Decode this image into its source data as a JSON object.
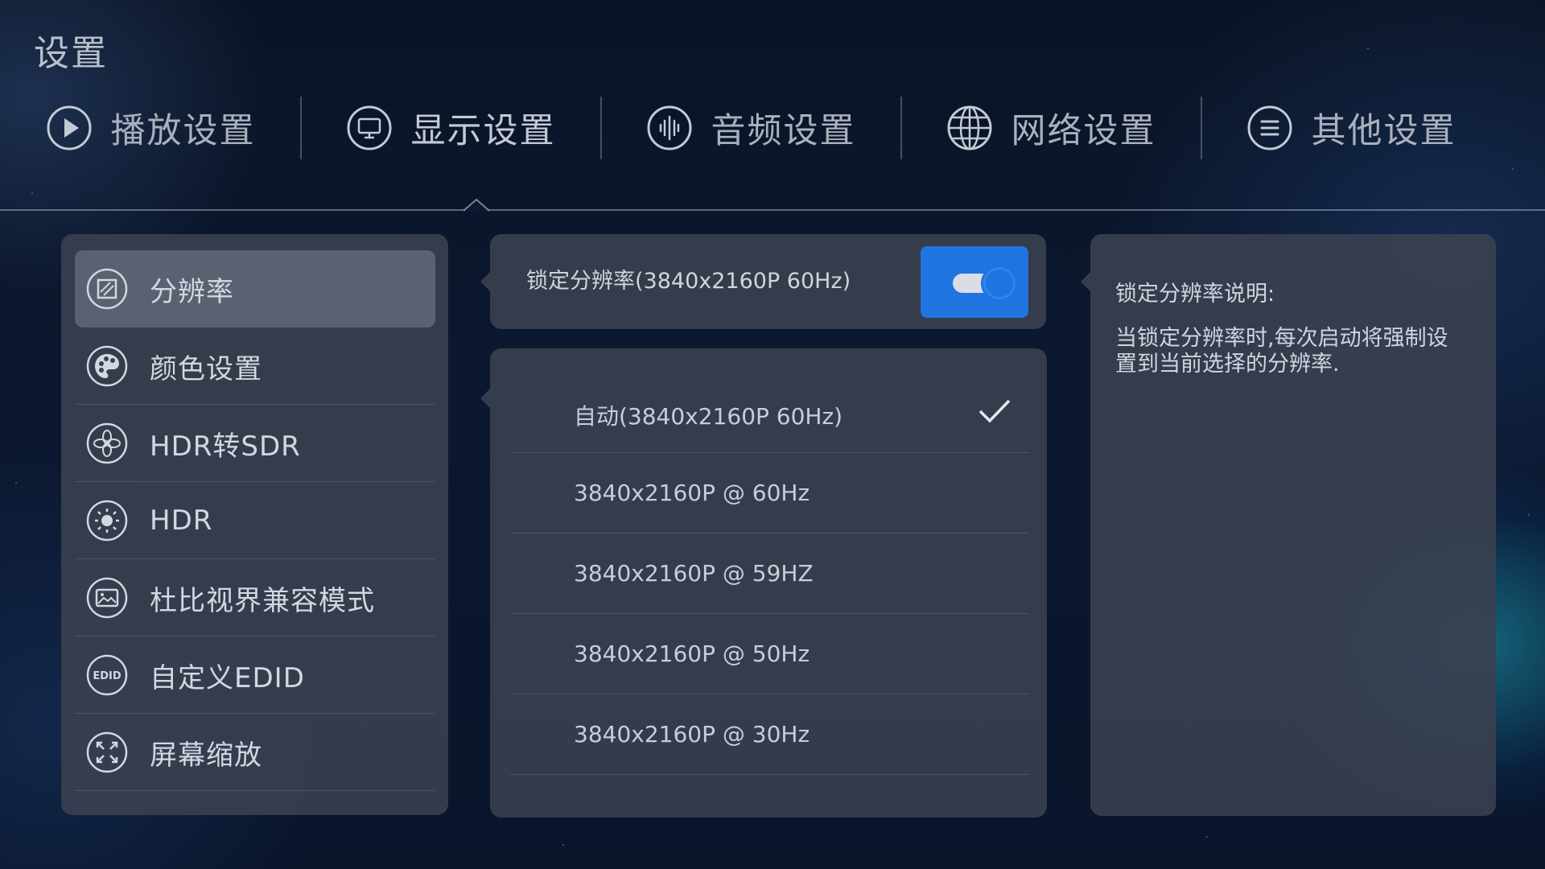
{
  "page": {
    "title": "设置"
  },
  "tabs": [
    {
      "label": "播放设置",
      "icon": "play-circle-icon"
    },
    {
      "label": "显示设置",
      "icon": "monitor-icon"
    },
    {
      "label": "音频设置",
      "icon": "audio-wave-icon"
    },
    {
      "label": "网络设置",
      "icon": "globe-icon"
    },
    {
      "label": "其他设置",
      "icon": "menu-list-icon"
    }
  ],
  "active_tab": 1,
  "sidebar": {
    "items": [
      {
        "label": "分辨率",
        "icon": "resolution-icon",
        "selected": true
      },
      {
        "label": "颜色设置",
        "icon": "palette-icon"
      },
      {
        "label": "HDR转SDR",
        "icon": "hdr-to-sdr-icon"
      },
      {
        "label": "HDR",
        "icon": "hdr-brightness-icon"
      },
      {
        "label": "杜比视界兼容模式",
        "icon": "image-frame-icon"
      },
      {
        "label": "自定义EDID",
        "icon": "edid-icon",
        "icon_text": "EDID"
      },
      {
        "label": "屏幕缩放",
        "icon": "expand-arrows-icon"
      }
    ]
  },
  "lock_resolution": {
    "label": "锁定分辨率(3840x2160P 60Hz)",
    "enabled": true
  },
  "resolution_options": {
    "items": [
      {
        "label": "自动(3840x2160P 60Hz)",
        "checked": true
      },
      {
        "label": "3840x2160P @ 60Hz"
      },
      {
        "label": "3840x2160P @ 59HZ"
      },
      {
        "label": "3840x2160P @ 50Hz"
      },
      {
        "label": "3840x2160P @ 30Hz"
      }
    ]
  },
  "info": {
    "title": "锁定分辨率说明:",
    "body": "当锁定分辨率时,每次启动将强制设置到当前选择的分辨率."
  },
  "colors": {
    "toggle_on": "#1f74e0",
    "panel": "#3a4050",
    "selected_item": "#5a6170"
  }
}
